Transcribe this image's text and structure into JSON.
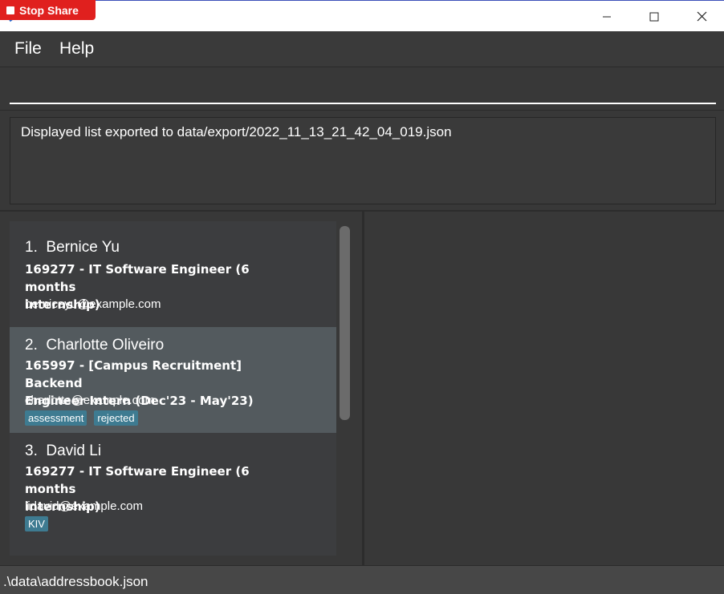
{
  "window": {
    "title": "t",
    "minimize_icon": "minimize-icon",
    "maximize_icon": "maximize-icon",
    "close_icon": "close-icon",
    "app_icon": "app-icon"
  },
  "stop_share": {
    "label": "Stop Share",
    "color": "#e0201e"
  },
  "menu": {
    "file": "File",
    "help": "Help"
  },
  "command": {
    "value": "",
    "placeholder": ""
  },
  "result": {
    "message": "Displayed list exported to data/export/2022_11_13_21_42_04_019.json"
  },
  "list": {
    "items": [
      {
        "index": "1.",
        "name": "Bernice Yu",
        "job_line1": "169277 - IT Software Engineer (6 months",
        "job_line2": "internship)",
        "email": "berniceyu@example.com",
        "tags": []
      },
      {
        "index": "2.",
        "name": "Charlotte Oliveiro",
        "job_line1": "165997 - [Campus Recruitment] Backend",
        "job_line2": "Engineer Intern (Dec'23 - May'23)",
        "email": "charlotte@example.com",
        "tags": [
          "assessment",
          "rejected"
        ]
      },
      {
        "index": "3.",
        "name": "David Li",
        "job_line1": "169277 - IT Software Engineer (6 months",
        "job_line2": "internship)",
        "email": "lidavid@example.com",
        "tags": [
          "KIV"
        ]
      }
    ]
  },
  "status": {
    "path": ".\\data\\addressbook.json"
  },
  "colors": {
    "background": "#383838",
    "card": "#3c3d3f",
    "card_selected": "#535a5e",
    "tag": "#3e7b91"
  }
}
